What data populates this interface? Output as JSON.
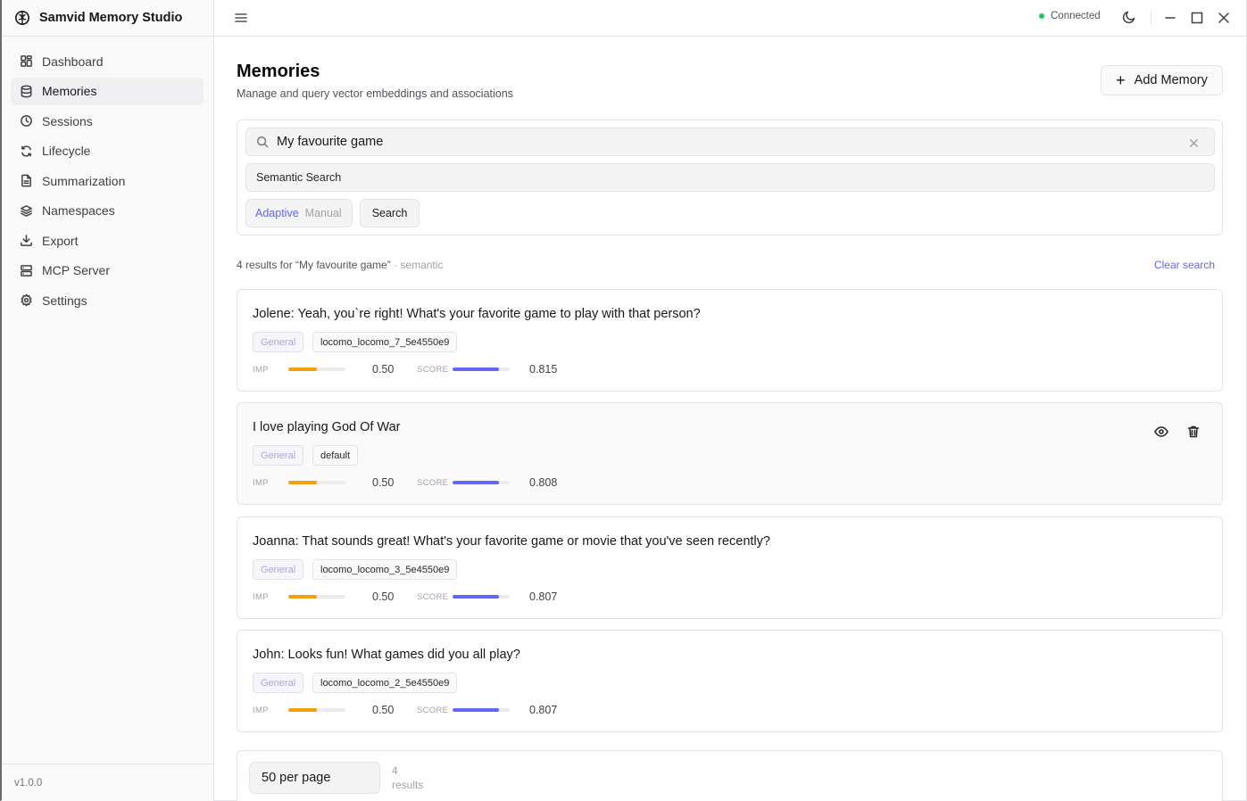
{
  "app": {
    "title": "Samvid Memory Studio",
    "version": "v1.0.0"
  },
  "sidebar": {
    "items": [
      {
        "label": "Dashboard",
        "icon": "dashboard-icon"
      },
      {
        "label": "Memories",
        "icon": "database-icon",
        "active": true
      },
      {
        "label": "Sessions",
        "icon": "clock-icon"
      },
      {
        "label": "Lifecycle",
        "icon": "refresh-icon"
      },
      {
        "label": "Summarization",
        "icon": "document-icon"
      },
      {
        "label": "Namespaces",
        "icon": "layers-icon"
      },
      {
        "label": "Export",
        "icon": "download-icon"
      },
      {
        "label": "MCP Server",
        "icon": "server-icon"
      },
      {
        "label": "Settings",
        "icon": "gear-icon"
      }
    ]
  },
  "topbar": {
    "status": "Connected",
    "status_color": "#22c55e"
  },
  "page": {
    "title": "Memories",
    "subtitle": "Manage and query vector embeddings and associations",
    "add_button": "Add Memory"
  },
  "search": {
    "query": "My favourite game",
    "mode": "Semantic Search",
    "toggle_on": "Adaptive",
    "toggle_off": "Manual",
    "button": "Search"
  },
  "results": {
    "summary": "4 results for “My favourite game”",
    "mode_suffix": " · semantic",
    "clear": "Clear search",
    "imp_label": "IMP",
    "score_label": "SCORE",
    "items": [
      {
        "text": "Jolene: Yeah, you`re right! What's your favorite game to play with that person?",
        "category": "General",
        "namespace": "locomo_locomo_7_5e4550e9",
        "importance": "0.50",
        "importance_fraction": 0.5,
        "score": "0.815",
        "score_fraction": 0.815
      },
      {
        "text": "I love playing God Of War",
        "category": "General",
        "namespace": "default",
        "importance": "0.50",
        "importance_fraction": 0.5,
        "score": "0.808",
        "score_fraction": 0.808
      },
      {
        "text": "Joanna: That sounds great! What's your favorite game or movie that you've seen recently?",
        "category": "General",
        "namespace": "locomo_locomo_3_5e4550e9",
        "importance": "0.50",
        "importance_fraction": 0.5,
        "score": "0.807",
        "score_fraction": 0.807
      },
      {
        "text": "John: Looks fun! What games did you all play?",
        "category": "General",
        "namespace": "locomo_locomo_2_5e4550e9",
        "importance": "0.50",
        "importance_fraction": 0.5,
        "score": "0.807",
        "score_fraction": 0.807
      }
    ]
  },
  "pagination": {
    "per_page": "50 per page",
    "count": "4",
    "count_label": "results"
  },
  "colors": {
    "accent": "#6366f1",
    "importance": "#f59e0b"
  }
}
